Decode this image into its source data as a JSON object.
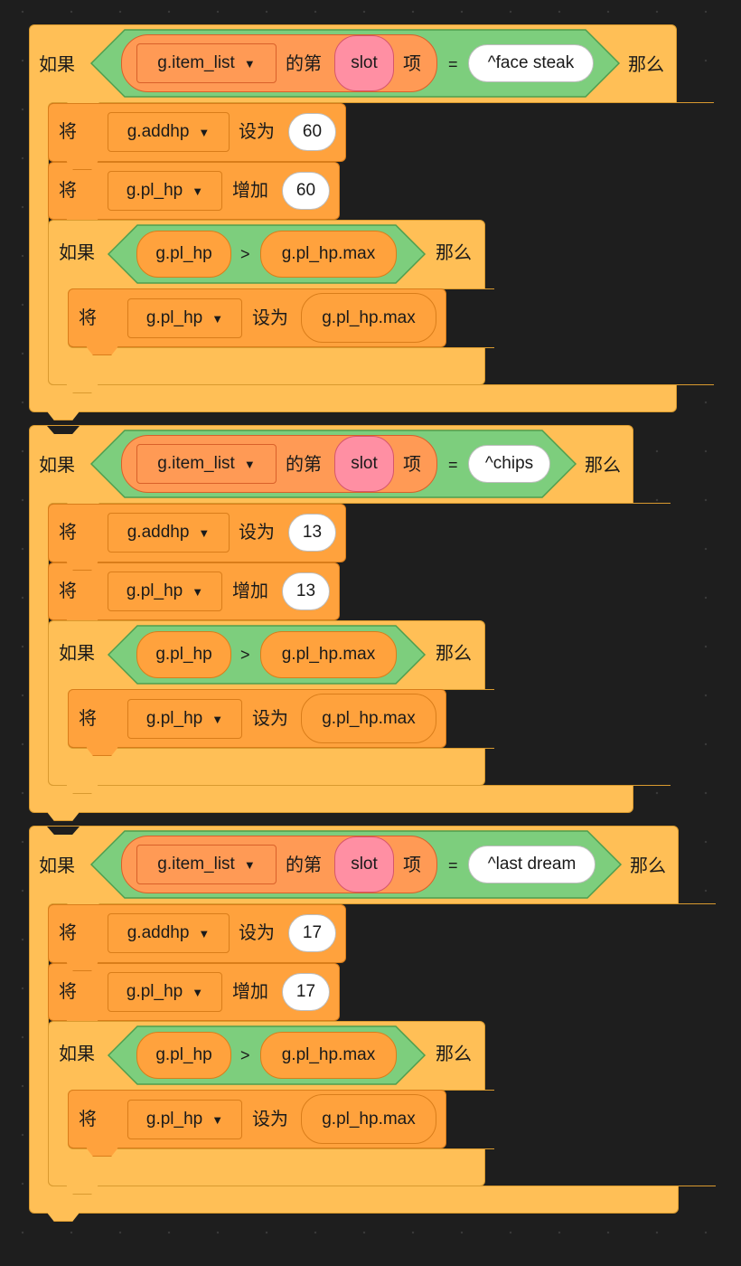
{
  "keywords": {
    "if": "如果",
    "then": "那么",
    "set": "将",
    "set_to": "设为",
    "change_by": "增加",
    "item_of": "的第",
    "item_suffix": "项",
    "equals": "=",
    "greater": ">"
  },
  "colors": {
    "control": "#ffbf56",
    "variable": "#ffa23d",
    "operator": "#7dce7d",
    "list": "#ff9a55",
    "slot_reporter": "#ff8fa3",
    "background": "#1e1e1e"
  },
  "icons": {
    "dropdown": "caret-down-icon"
  },
  "script": {
    "blocks": [
      {
        "list_var": "g.item_list",
        "index_var": "slot",
        "compare_text": "^face steak",
        "addhp_var": "g.addhp",
        "addhp_value": "60",
        "hp_var": "g.pl_hp",
        "hp_change": "60",
        "cond_left": "g.pl_hp",
        "cond_right": "g.pl_hp.max",
        "inner_var": "g.pl_hp",
        "inner_value": "g.pl_hp.max"
      },
      {
        "list_var": "g.item_list",
        "index_var": "slot",
        "compare_text": "^chips",
        "addhp_var": "g.addhp",
        "addhp_value": "13",
        "hp_var": "g.pl_hp",
        "hp_change": "13",
        "cond_left": "g.pl_hp",
        "cond_right": "g.pl_hp.max",
        "inner_var": "g.pl_hp",
        "inner_value": "g.pl_hp.max"
      },
      {
        "list_var": "g.item_list",
        "index_var": "slot",
        "compare_text": "^last dream",
        "addhp_var": "g.addhp",
        "addhp_value": "17",
        "hp_var": "g.pl_hp",
        "hp_change": "17",
        "cond_left": "g.pl_hp",
        "cond_right": "g.pl_hp.max",
        "inner_var": "g.pl_hp",
        "inner_value": "g.pl_hp.max"
      }
    ]
  }
}
